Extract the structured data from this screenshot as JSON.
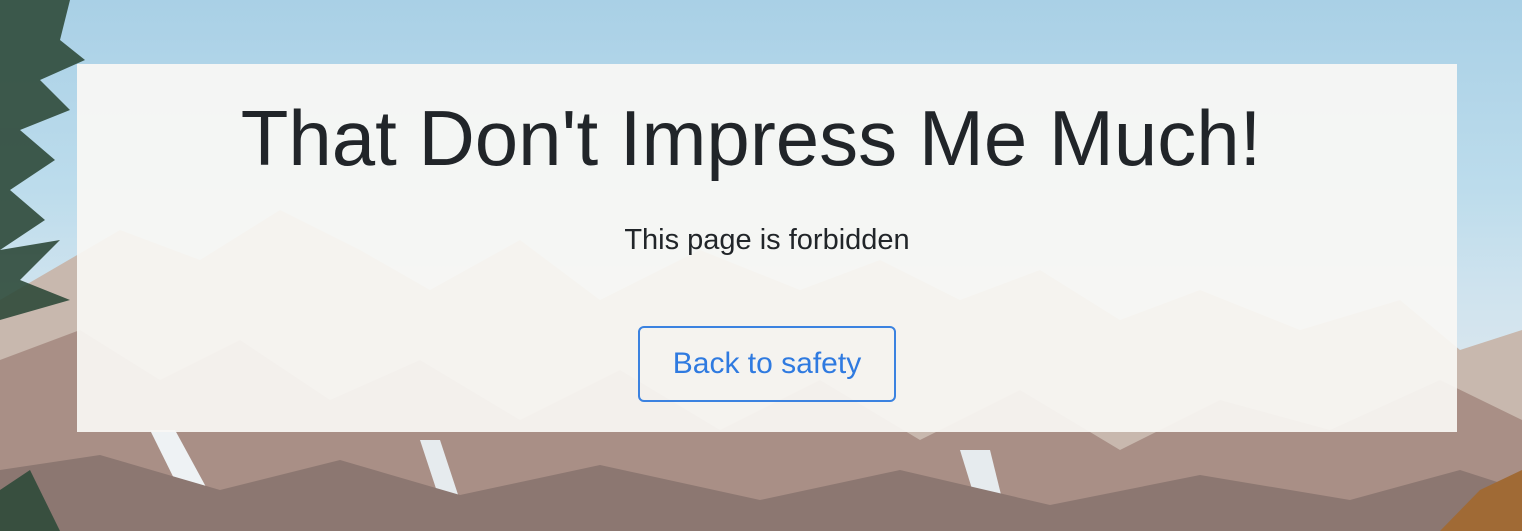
{
  "hero": {
    "title": "That Don't Impress Me Much!",
    "message": "This page is forbidden",
    "button_label": "Back to safety"
  },
  "colors": {
    "text": "#212529",
    "button_border": "#3b82e0",
    "button_text": "#2f7ae0",
    "panel": "#f9f8f4",
    "sky": "#a9d0e6"
  }
}
